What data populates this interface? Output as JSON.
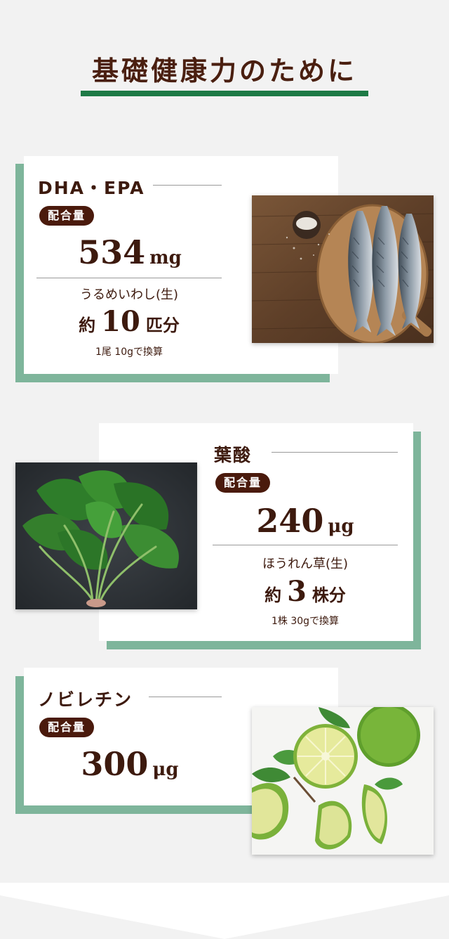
{
  "heading": "基礎健康力のために",
  "sections": [
    {
      "title": "DHA・EPA",
      "badge": "配合量",
      "amount": "534",
      "unit": "mg",
      "food": "うるめいわし(生)",
      "equiv_prefix": "約",
      "equiv_value": "10",
      "equiv_suffix": "匹分",
      "note": "1尾 10gで換算",
      "image": "fish-on-cutting-board-photo"
    },
    {
      "title": "葉酸",
      "badge": "配合量",
      "amount": "240",
      "unit": "μg",
      "food": "ほうれん草(生)",
      "equiv_prefix": "約",
      "equiv_value": "3",
      "equiv_suffix": "株分",
      "note": "1株 30gで換算",
      "image": "spinach-photo"
    },
    {
      "title": "ノビレチン",
      "badge": "配合量",
      "amount": "300",
      "unit": "μg",
      "image": "lime-and-mint-photo"
    }
  ],
  "colors": {
    "accent_green": "#1e7a46",
    "card_shadow_green": "#7eb59b",
    "badge_brown": "#4a1a0c",
    "text_brown": "#3d1a0e"
  }
}
